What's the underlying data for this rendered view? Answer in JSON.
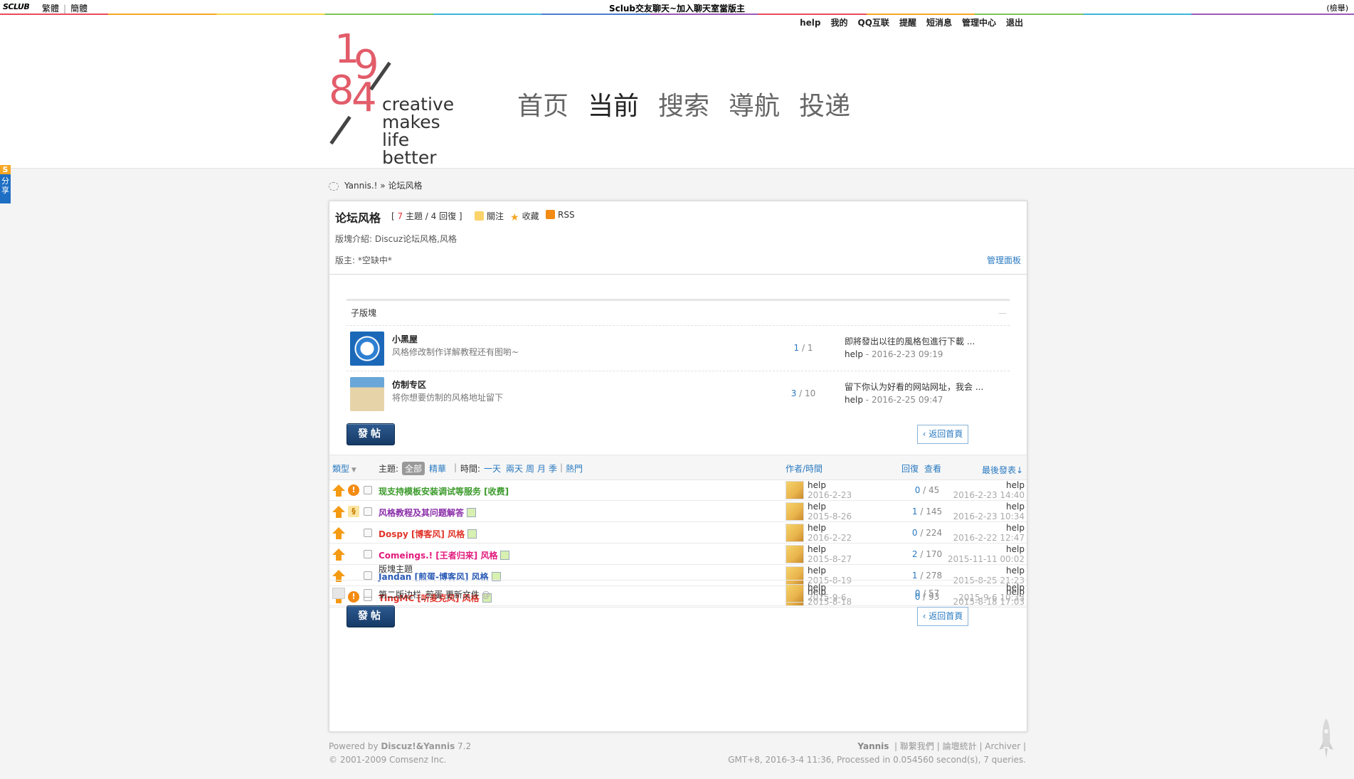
{
  "topbar": {
    "logo": "SCLUB",
    "trad": "繁體",
    "simp": "簡體",
    "title": "Sclub交友聊天~加入聊天室當版主",
    "right": "(檢舉)"
  },
  "usernav": [
    "help",
    "我的",
    "QQ互联",
    "提醒",
    "短消息",
    "管理中心",
    "退出"
  ],
  "logo": {
    "digits": [
      "1",
      "9",
      "8",
      "4"
    ],
    "tagline": [
      "creative",
      "makes",
      "life",
      "better"
    ]
  },
  "mainnav": [
    {
      "label": "首页",
      "active": false
    },
    {
      "label": "当前",
      "active": true
    },
    {
      "label": "搜索",
      "active": false
    },
    {
      "label": "導航",
      "active": false
    },
    {
      "label": "投递",
      "active": false
    }
  ],
  "share": {
    "badge": "S",
    "label": "分享"
  },
  "breadcrumb": {
    "site": "Yannis.!",
    "sep": "»",
    "current": "论坛风格"
  },
  "forum": {
    "title": "论坛风格",
    "stats_prefix": "[",
    "topics": "7",
    "stats_mid": "主題 / 4 回復 ]",
    "follow": "關注",
    "favorite": "收藏",
    "rss": "RSS",
    "description": "版塊介紹: Discuz论坛风格,风格",
    "moderator": "版主: *空缺中*",
    "admin_panel": "管理面板",
    "subforum_header": "子版塊",
    "collapse": "—"
  },
  "subforums": [
    {
      "name": "小黑屋",
      "desc": "风格修改制作详解教程还有图喲~",
      "threads": "1",
      "posts": "1",
      "last_title": "即將發出以往的風格包進行下載 ...",
      "last_user": "help",
      "last_time": "2016-2-23 09:19"
    },
    {
      "name": "仿制专区",
      "desc": "将你想要仿制的风格地址留下",
      "threads": "3",
      "posts": "10",
      "last_title": "留下你认为好看的网站网址，我会 ...",
      "last_user": "help",
      "last_time": "2016-2-25 09:47"
    }
  ],
  "buttons": {
    "post": "發帖",
    "back": "返回首頁"
  },
  "filter": {
    "type": "類型",
    "topic_label": "主題:",
    "all": "全部",
    "digest": "精華",
    "time_label": "時間:",
    "day": "一天",
    "twodays": "兩天",
    "week": "周",
    "month": "月",
    "season": "季",
    "hot": "熱門",
    "author": "作者/時間",
    "replies": "回復",
    "views": "查看",
    "lastpost": "最後發表↓"
  },
  "threads": [
    {
      "title": "现支持模板安装调试等服务 [收费]",
      "color": "green",
      "icon": "!",
      "img": false,
      "author": "help",
      "date": "2016-2-23",
      "replies": "0",
      "views": "45",
      "last_user": "help",
      "last_time": "2016-2-23 14:40"
    },
    {
      "title": "风格教程及其问题解答",
      "color": "purple",
      "icon": "scroll",
      "img": true,
      "author": "help",
      "date": "2015-8-26",
      "replies": "1",
      "views": "145",
      "last_user": "help",
      "last_time": "2016-2-23 10:34"
    },
    {
      "title": "Dospy [博客风] 风格",
      "color": "red",
      "icon": "",
      "img": true,
      "author": "help",
      "date": "2016-2-22",
      "replies": "0",
      "views": "224",
      "last_user": "help",
      "last_time": "2016-2-22 12:47"
    },
    {
      "title": "Comeings.! [王者归来] 风格",
      "color": "pink",
      "icon": "",
      "img": true,
      "author": "help",
      "date": "2015-8-27",
      "replies": "2",
      "views": "170",
      "last_user": "help",
      "last_time": "2015-11-11 00:02"
    },
    {
      "title": "Jandan [煎蛋-博客风] 风格",
      "color": "blue",
      "icon": "",
      "img": true,
      "author": "help",
      "date": "2015-8-19",
      "replies": "1",
      "views": "278",
      "last_user": "help",
      "last_time": "2015-8-25 21:23"
    },
    {
      "title": "TingMC [听麦克风] 风格",
      "color": "red",
      "icon": "!",
      "img": true,
      "author": "help",
      "date": "2015-8-18",
      "replies": "0",
      "views": "93",
      "last_user": "help",
      "last_time": "2015-8-18 17:03"
    }
  ],
  "section_label": "版塊主題",
  "normal_thread": {
    "title": "第二版边栏_煎蛋 更新文件",
    "attach": "@",
    "author": "help",
    "date": "2015-9-6",
    "replies": "0",
    "views": "57",
    "last_user": "help",
    "last_time": "2015-9-6 10:33"
  },
  "footer": {
    "powered_prefix": "Powered by",
    "powered_name": "Discuz!&Yannis",
    "version": "7.2",
    "copyright": "© 2001-2009 Comsenz Inc.",
    "site": "Yannis",
    "contact": "聯繫我們",
    "stats": "論壇統計",
    "archiver": "Archiver",
    "processed": "GMT+8, 2016-3-4 11:36, Processed in 0.054560 second(s), 7 queries."
  }
}
